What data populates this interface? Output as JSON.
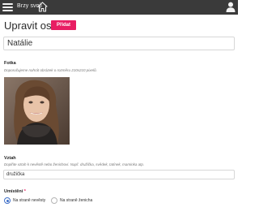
{
  "topbar": {
    "brand": "Brzy svoji",
    "menu_icon": "hamburger-icon",
    "home_icon": "home-icon",
    "user_icon": "user-icon",
    "bg_color": "#3a3a3a"
  },
  "page": {
    "title": "Upravit osobu",
    "add_button_label": "Přidat",
    "accent_color": "#e81e63"
  },
  "form": {
    "name_value": "Natálie",
    "photo": {
      "label": "Fotka",
      "hint": "Doporučujeme nahrát obrázek o rozměru 210x210 pixelů."
    },
    "relationship": {
      "label": "Vztah",
      "hint": "Doplňte vztah k nevěstě nebo ženichovi. Např. družička, svědek, tatínek, maminka atp.",
      "value": "družička"
    },
    "placement": {
      "label": "Umístění",
      "required_mark": "*",
      "options": [
        {
          "label": "Na straně nevěsty",
          "selected": true
        },
        {
          "label": "Na straně ženicha",
          "selected": false
        }
      ]
    }
  }
}
